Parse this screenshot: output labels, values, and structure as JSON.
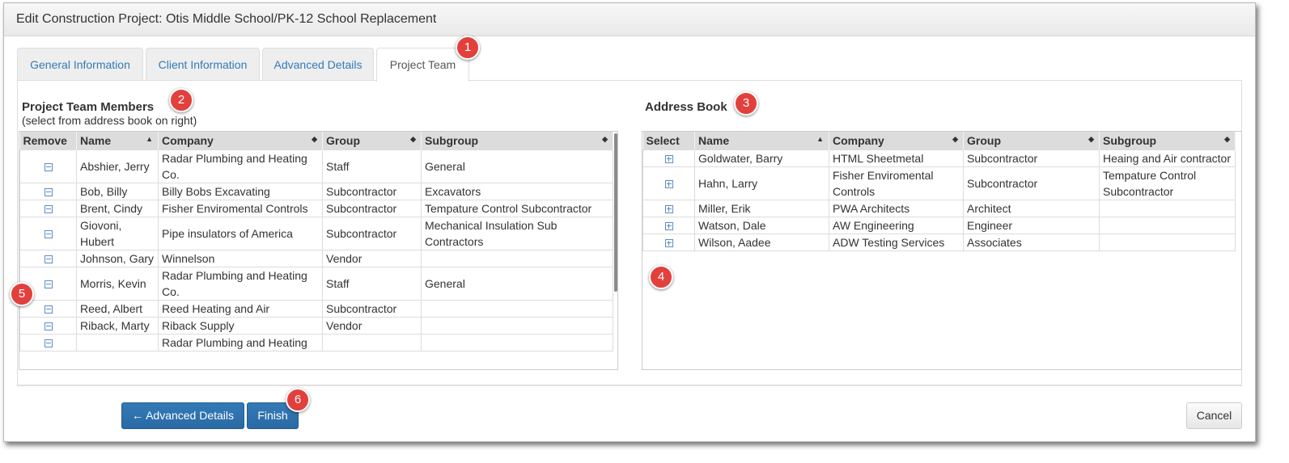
{
  "window": {
    "title": "Edit Construction Project: Otis Middle School/PK-12 School Replacement"
  },
  "tabs": [
    {
      "label": "General Information"
    },
    {
      "label": "Client Information"
    },
    {
      "label": "Advanced Details"
    },
    {
      "label": "Project Team",
      "active": true
    }
  ],
  "team": {
    "title": "Project Team Members",
    "subtitle": "(select from address book on right)",
    "columns": [
      "Remove",
      "Name",
      "Company",
      "Group",
      "Subgroup"
    ],
    "rows": [
      {
        "name": "Abshier, Jerry",
        "company": "Radar Plumbing and Heating Co.",
        "group": "Staff",
        "subgroup": "General"
      },
      {
        "name": "Bob, Billy",
        "company": "Billy Bobs Excavating",
        "group": "Subcontractor",
        "subgroup": "Excavators"
      },
      {
        "name": "Brent, Cindy",
        "company": "Fisher Enviromental Controls",
        "group": "Subcontractor",
        "subgroup": "Tempature Control Subcontractor"
      },
      {
        "name": "Giovoni, Hubert",
        "company": "Pipe insulators of America",
        "group": "Subcontractor",
        "subgroup": "Mechanical Insulation Sub Contractors"
      },
      {
        "name": "Johnson, Gary",
        "company": "Winnelson",
        "group": "Vendor",
        "subgroup": ""
      },
      {
        "name": "Morris, Kevin",
        "company": "Radar Plumbing and Heating Co.",
        "group": "Staff",
        "subgroup": "General"
      },
      {
        "name": "Reed, Albert",
        "company": "Reed Heating and Air",
        "group": "Subcontractor",
        "subgroup": ""
      },
      {
        "name": "Riback, Marty",
        "company": "Riback Supply",
        "group": "Vendor",
        "subgroup": ""
      },
      {
        "name": "",
        "company": "Radar Plumbing and Heating",
        "group": "",
        "subgroup": ""
      }
    ]
  },
  "address_book": {
    "title": "Address Book",
    "columns": [
      "Select",
      "Name",
      "Company",
      "Group",
      "Subgroup"
    ],
    "rows": [
      {
        "name": "Goldwater, Barry",
        "company": "HTML Sheetmetal",
        "group": "Subcontractor",
        "subgroup": "Heaing and Air contractor"
      },
      {
        "name": "Hahn, Larry",
        "company": "Fisher Enviromental Controls",
        "group": "Subcontractor",
        "subgroup": "Tempature Control Subcontractor"
      },
      {
        "name": "Miller, Erik",
        "company": "PWA Architects",
        "group": "Architect",
        "subgroup": ""
      },
      {
        "name": "Watson, Dale",
        "company": "AW Engineering",
        "group": "Engineer",
        "subgroup": ""
      },
      {
        "name": "Wilson, Aadee",
        "company": "ADW Testing Services",
        "group": "Associates",
        "subgroup": ""
      }
    ]
  },
  "buttons": {
    "back": "← Advanced Details",
    "finish": "Finish",
    "cancel": "Cancel"
  },
  "callouts": [
    "1",
    "2",
    "3",
    "4",
    "5",
    "6"
  ],
  "colors": {
    "primary": "#337ab7",
    "callout": "#e2403c",
    "header_bg": "#dcdcdc",
    "link": "#337ab7"
  }
}
